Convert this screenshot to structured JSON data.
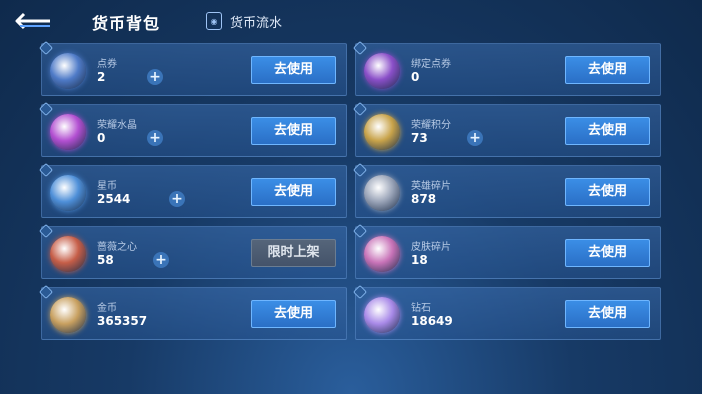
{
  "header": {
    "title": "货币背包",
    "flow_label": "货币流水"
  },
  "left": [
    {
      "name": "点券",
      "value": "2",
      "plus": true,
      "button": "去使用",
      "button_enabled": true,
      "icon": "coupon-card-icon",
      "color": "#4f7bc8"
    },
    {
      "name": "荣耀水晶",
      "value": "0",
      "plus": true,
      "button": "去使用",
      "button_enabled": true,
      "icon": "glory-crystal-icon",
      "color": "#b24fd1"
    },
    {
      "name": "星币",
      "value": "2544",
      "plus": true,
      "button": "去使用",
      "button_enabled": true,
      "icon": "star-coin-icon",
      "color": "#4e8fd8"
    },
    {
      "name": "蔷薇之心",
      "value": "58",
      "plus": true,
      "button": "限时上架",
      "button_enabled": false,
      "icon": "rose-heart-icon",
      "color": "#c65e48"
    },
    {
      "name": "金币",
      "value": "365357",
      "plus": false,
      "button": "去使用",
      "button_enabled": true,
      "icon": "gold-coin-icon",
      "color": "#c8a060"
    }
  ],
  "right": [
    {
      "name": "绑定点券",
      "value": "0",
      "plus": false,
      "button": "去使用",
      "button_enabled": true,
      "icon": "bound-coupon-card-icon",
      "color": "#8a4fc8"
    },
    {
      "name": "荣耀积分",
      "value": "73",
      "plus": true,
      "button": "去使用",
      "button_enabled": true,
      "icon": "glory-points-icon",
      "color": "#c8a34a"
    },
    {
      "name": "英雄碎片",
      "value": "878",
      "plus": false,
      "button": "去使用",
      "button_enabled": true,
      "icon": "hero-fragment-icon",
      "color": "#9aa4b8"
    },
    {
      "name": "皮肤碎片",
      "value": "18",
      "plus": false,
      "button": "去使用",
      "button_enabled": true,
      "icon": "skin-fragment-icon",
      "color": "#c873b8"
    },
    {
      "name": "钻石",
      "value": "18649",
      "plus": false,
      "button": "去使用",
      "button_enabled": true,
      "icon": "diamond-icon",
      "color": "#a98ae8"
    }
  ]
}
